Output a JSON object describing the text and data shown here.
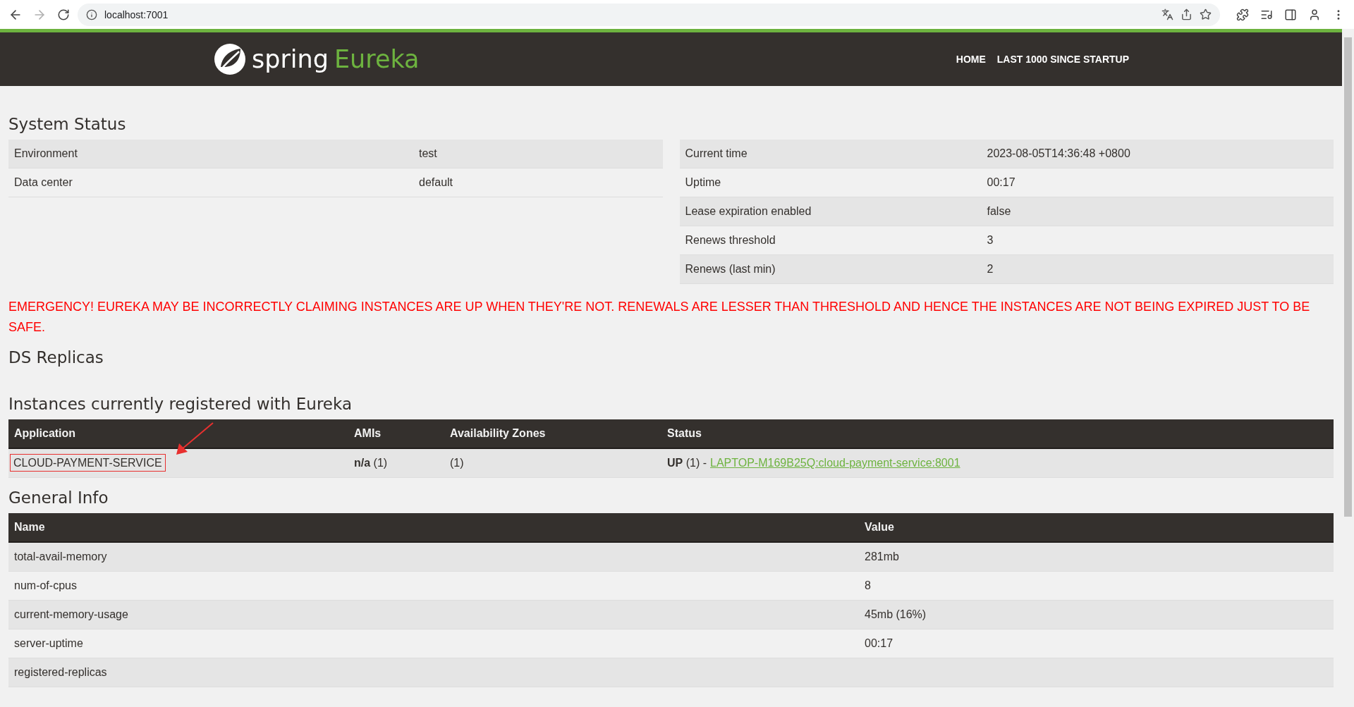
{
  "browser": {
    "url": "localhost:7001",
    "forward_disabled": true
  },
  "header": {
    "logo_word": "spring",
    "product": "Eureka",
    "nav": [
      {
        "label": "HOME"
      },
      {
        "label": "LAST 1000 SINCE STARTUP"
      }
    ]
  },
  "system_status": {
    "title": "System Status",
    "left": [
      {
        "label": "Environment",
        "value": "test"
      },
      {
        "label": "Data center",
        "value": "default"
      }
    ],
    "right": [
      {
        "label": "Current time",
        "value": "2023-08-05T14:36:48 +0800"
      },
      {
        "label": "Uptime",
        "value": "00:17"
      },
      {
        "label": "Lease expiration enabled",
        "value": "false"
      },
      {
        "label": "Renews threshold",
        "value": "3"
      },
      {
        "label": "Renews (last min)",
        "value": "2"
      }
    ]
  },
  "alert": "EMERGENCY! EUREKA MAY BE INCORRECTLY CLAIMING INSTANCES ARE UP WHEN THEY'RE NOT. RENEWALS ARE LESSER THAN THRESHOLD AND HENCE THE INSTANCES ARE NOT BEING EXPIRED JUST TO BE SAFE.",
  "ds_replicas": {
    "title": "DS Replicas"
  },
  "instances": {
    "title": "Instances currently registered with Eureka",
    "columns": [
      "Application",
      "AMIs",
      "Availability Zones",
      "Status"
    ],
    "rows": [
      {
        "application": "CLOUD-PAYMENT-SERVICE",
        "highlighted": true,
        "amis": "**n/a** (1)",
        "zones": "(1)",
        "status": "**UP** (1) -",
        "link": "LAPTOP-M169B25Q:cloud-payment-service:8001"
      }
    ]
  },
  "general_info": {
    "title": "General Info",
    "columns": [
      "Name",
      "Value"
    ],
    "rows": [
      {
        "name": "total-avail-memory",
        "value": "281mb"
      },
      {
        "name": "num-of-cpus",
        "value": "8"
      },
      {
        "name": "current-memory-usage",
        "value": "45mb (16%)"
      },
      {
        "name": "server-uptime",
        "value": "00:17"
      },
      {
        "name": "registered-replicas"
      }
    ]
  }
}
